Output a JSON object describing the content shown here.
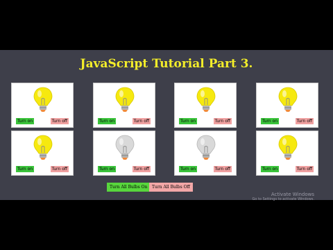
{
  "page": {
    "title": "JavaScript Tutorial Part 3."
  },
  "colors": {
    "background": "#3e3f4a",
    "title": "#f4ee2a",
    "bulb_on": "#f6e90f",
    "bulb_off": "#d9d9d9",
    "btn_on": "#3bc43b",
    "btn_off": "#f0a1a1"
  },
  "labels": {
    "turn_on": "Turn on",
    "turn_off": "Turn off"
  },
  "bulbs": [
    {
      "state": "on"
    },
    {
      "state": "on"
    },
    {
      "state": "on"
    },
    {
      "state": "on"
    },
    {
      "state": "on"
    },
    {
      "state": "off"
    },
    {
      "state": "off"
    },
    {
      "state": "on"
    }
  ],
  "controls": {
    "all_on": "Turn All Bulbs On",
    "all_off": "Turn All Bulbs Off"
  },
  "watermark": {
    "title": "Activate Windows",
    "subtitle": "Go to Settings to activate Windows."
  }
}
